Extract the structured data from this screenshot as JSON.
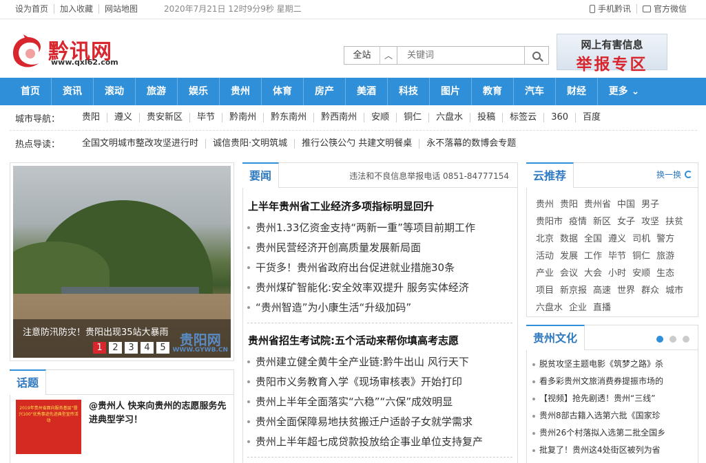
{
  "topbar": {
    "links": [
      "设为首页",
      "加入收藏",
      "网站地图"
    ],
    "datetime": "2020年7月21日 12时9分9秒 星期二",
    "mobile": "手机黔讯",
    "wechat": "官方微信"
  },
  "logo": {
    "name": "黔讯网",
    "url": "www.qxl62.com"
  },
  "search": {
    "scope": "全站",
    "placeholder": "关键词"
  },
  "report": {
    "line1": "网上有害信息",
    "line2": "举报专区"
  },
  "nav": [
    "首页",
    "资讯",
    "滚动",
    "旅游",
    "娱乐",
    "贵州",
    "体育",
    "房产",
    "美酒",
    "科技",
    "图片",
    "教育",
    "汽车",
    "财经",
    "更多"
  ],
  "city_nav": {
    "label": "城市导航：",
    "items": [
      "贵阳",
      "遵义",
      "贵安新区",
      "毕节",
      "黔南州",
      "黔东南州",
      "黔西南州",
      "安顺",
      "铜仁",
      "六盘水",
      "投稿",
      "标签云",
      "360",
      "百度"
    ]
  },
  "hot_nav": {
    "label": "热点导读：",
    "items": [
      "全国文明城市整改攻坚进行时",
      "诚信贵阳·文明筑城",
      "推行公筷公勺 共建文明餐桌",
      "永不落幕的数博会专题"
    ]
  },
  "slider": {
    "caption": "注意防汛防灾！贵阳出现35站大暴雨",
    "pages": [
      "1",
      "2",
      "3",
      "4",
      "5"
    ],
    "active_page": 1,
    "watermark": "贵阳网",
    "watermark_sub": "WWW.GYWB.CN"
  },
  "topic": {
    "title": "话题",
    "thumb_text": "2019年贵州省面向服务基层“暨兴100”优秀事迹先进典型宣传活动",
    "headline": "@贵州人 快来向贵州的志愿服务先进典型学习！"
  },
  "news": {
    "title": "要闻",
    "tel": "违法和不良信息举报电话 0851-84777154",
    "groups": [
      {
        "headline": "上半年贵州省工业经济多项指标明显回升",
        "items": [
          "贵州1.33亿资金支持“两新一重”等项目前期工作",
          "贵州民营经济开创高质量发展新局面",
          "干货多！贵州省政府出台促进就业措施30条",
          "贵州煤矿智能化:安全效率双提升 服务实体经济",
          "“贵州智造”为小康生活“升级加码”"
        ]
      },
      {
        "headline": "贵州省招生考试院:五个活动来帮你填高考志愿",
        "items": [
          "贵州建立健全黄牛全产业链:黔牛出山 风行天下",
          "贵阳市义务教育入学《现场审核表》开始打印",
          "贵州上半年全面落实“六稳”“六保”成效明显",
          "贵州全面保障易地扶贫搬迁户适龄子女就学需求",
          "贵州上半年超七成贷款投放给企事业单位支持复产"
        ]
      }
    ]
  },
  "recommend": {
    "title": "云推荐",
    "refresh": "换一换",
    "tags": [
      "贵州",
      "贵阳",
      "贵州省",
      "中国",
      "男子",
      "贵阳市",
      "疫情",
      "新区",
      "女子",
      "攻坚",
      "扶贫",
      "北京",
      "数据",
      "全国",
      "遵义",
      "司机",
      "警方",
      "活动",
      "发展",
      "工作",
      "毕节",
      "铜仁",
      "旅游",
      "产业",
      "会议",
      "大会",
      "小时",
      "安顺",
      "生态",
      "项目",
      "新京报",
      "高速",
      "世界",
      "群众",
      "城市",
      "六盘水",
      "企业",
      "直播"
    ]
  },
  "culture": {
    "title": "贵州文化",
    "active_dot": 1,
    "items": [
      "脱贫攻坚主题电影《筑梦之路》杀",
      "看多彩贵州文旅消费券提振市场的",
      "【视频】抢先剧透！贵州“三线”",
      "贵州8部古籍入选第六批《国家珍",
      "贵州26个村落拟入选第二批全国乡",
      "批复了！贵州这4处街区被列为省"
    ]
  },
  "colors": {
    "accent": "#2f8fd8",
    "brand_red": "#d8262e"
  }
}
